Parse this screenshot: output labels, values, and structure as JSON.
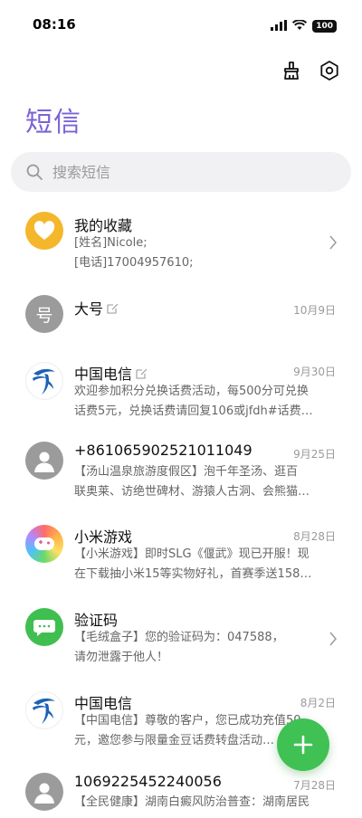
{
  "status_bar": {
    "time": "08:16",
    "battery": "100"
  },
  "header": {
    "title": "短信"
  },
  "search": {
    "placeholder": "搜索短信"
  },
  "conversations": [
    {
      "title": "我的收藏",
      "line1": "[姓名]Nicole;",
      "line2": "[电话]17004957610;",
      "date": ""
    },
    {
      "title": "大号",
      "line1": "",
      "line2": "",
      "date": "10月9日"
    },
    {
      "title": "中国电信",
      "line1": "欢迎参加积分兑换话费活动，每500分可兑换",
      "line2": "话费5元，兑换话费请回复106或jfdh#话费…",
      "date": "9月30日"
    },
    {
      "title": "+861065902521011049",
      "line1": "【汤山温泉旅游度假区】泡千年圣汤、逛百",
      "line2": "联奥莱、访绝世碑材、游猿人古洞、会熊猫…",
      "date": "9月25日"
    },
    {
      "title": "小米游戏",
      "line1": "【小米游戏】即时SLG《偃武》现已开服！现",
      "line2": "在下载抽小米15等实物好礼，首赛季送158…",
      "date": "8月28日"
    },
    {
      "title": "验证码",
      "line1": "【毛绒盒子】您的验证码为：047588，",
      "line2": "请勿泄露于他人！",
      "date": ""
    },
    {
      "title": "中国电信",
      "line1": "【中国电信】尊敬的客户，您已成功充值50",
      "line2": "元，邀您参与限量金豆话费转盘活动…",
      "date": "8月2日"
    },
    {
      "title": "1069225452240056",
      "line1": "【全民健康】湖南白癜风防治普查：湖南居民",
      "line2": "",
      "date": "7月28日"
    }
  ],
  "avatars": {
    "placeholder_char": "号"
  },
  "colors": {
    "accent": "#7b63d6",
    "fab": "#3fc153"
  },
  "icons": [
    "cleanup-brush-icon",
    "settings-gear-icon",
    "search-icon",
    "chevron-right-icon",
    "edit-icon",
    "add-icon"
  ]
}
